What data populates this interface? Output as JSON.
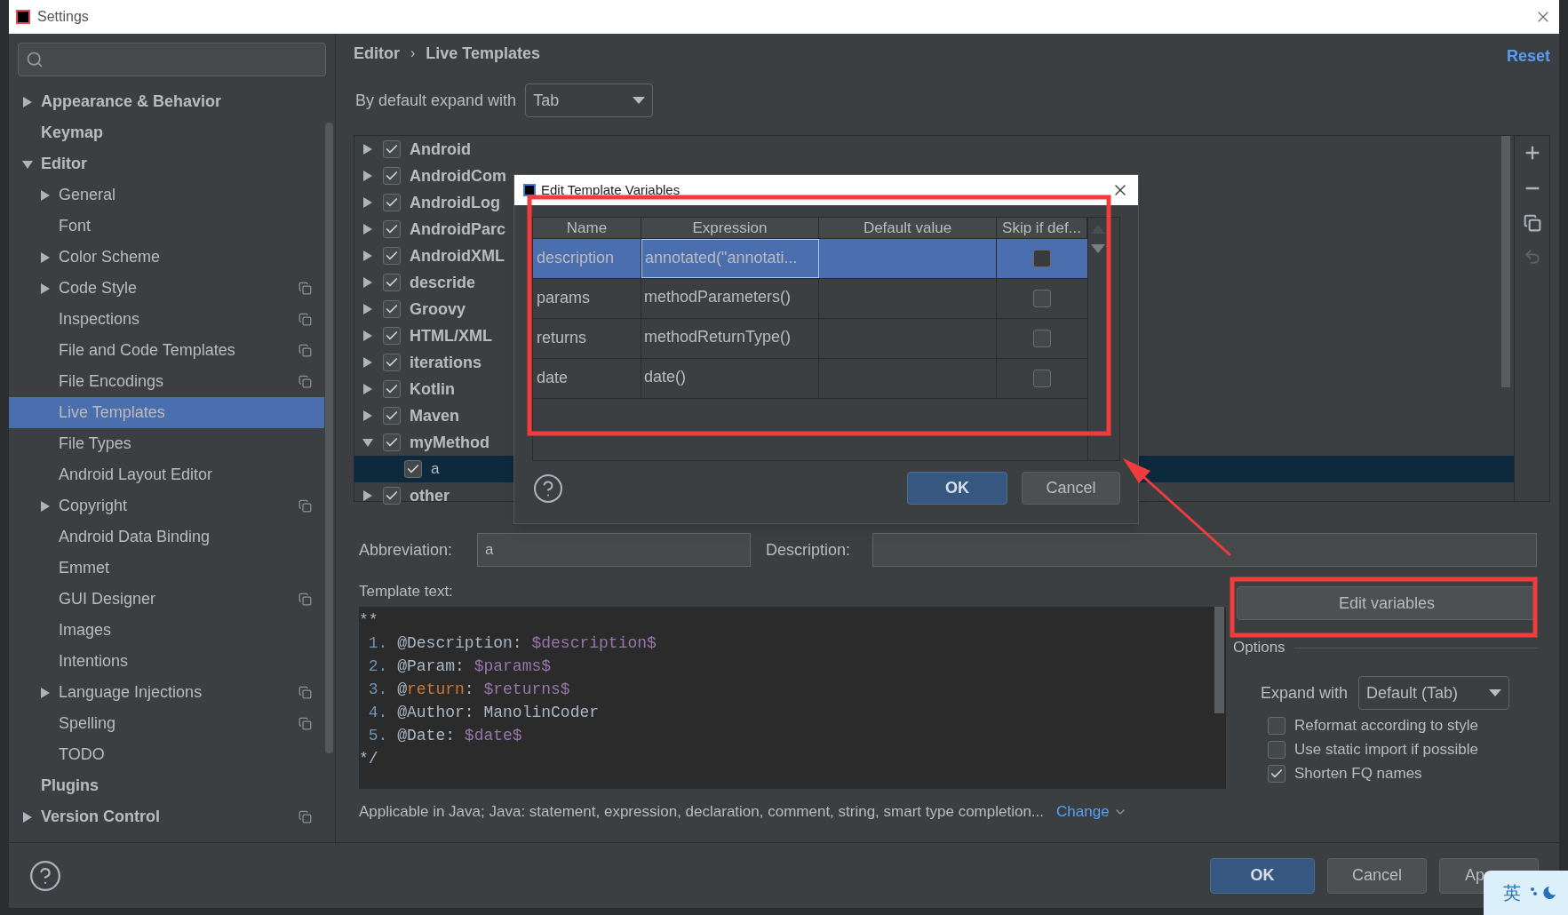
{
  "window": {
    "title": "Settings"
  },
  "sidebar": {
    "items": [
      {
        "label": "Appearance & Behavior",
        "kind": "node",
        "expanded": false,
        "selected": false,
        "project_level": false
      },
      {
        "label": "Keymap",
        "kind": "leaf",
        "selected": false,
        "project_level": false
      },
      {
        "label": "Editor",
        "kind": "node",
        "expanded": true,
        "selected": false,
        "project_level": false,
        "children": [
          {
            "label": "General",
            "kind": "node",
            "expanded": false,
            "selected": false,
            "project_level": false
          },
          {
            "label": "Font",
            "kind": "leaf",
            "selected": false,
            "project_level": false
          },
          {
            "label": "Color Scheme",
            "kind": "node",
            "expanded": false,
            "selected": false,
            "project_level": false
          },
          {
            "label": "Code Style",
            "kind": "node",
            "expanded": false,
            "selected": false,
            "project_level": true
          },
          {
            "label": "Inspections",
            "kind": "leaf",
            "selected": false,
            "project_level": true
          },
          {
            "label": "File and Code Templates",
            "kind": "leaf",
            "selected": false,
            "project_level": true
          },
          {
            "label": "File Encodings",
            "kind": "leaf",
            "selected": false,
            "project_level": true
          },
          {
            "label": "Live Templates",
            "kind": "leaf",
            "selected": true,
            "project_level": false
          },
          {
            "label": "File Types",
            "kind": "leaf",
            "selected": false,
            "project_level": false
          },
          {
            "label": "Android Layout Editor",
            "kind": "leaf",
            "selected": false,
            "project_level": false
          },
          {
            "label": "Copyright",
            "kind": "node",
            "expanded": false,
            "selected": false,
            "project_level": true
          },
          {
            "label": "Android Data Binding",
            "kind": "leaf",
            "selected": false,
            "project_level": false
          },
          {
            "label": "Emmet",
            "kind": "leaf",
            "selected": false,
            "project_level": false
          },
          {
            "label": "GUI Designer",
            "kind": "leaf",
            "selected": false,
            "project_level": true
          },
          {
            "label": "Images",
            "kind": "leaf",
            "selected": false,
            "project_level": false
          },
          {
            "label": "Intentions",
            "kind": "leaf",
            "selected": false,
            "project_level": false
          },
          {
            "label": "Language Injections",
            "kind": "node",
            "expanded": false,
            "selected": false,
            "project_level": true
          },
          {
            "label": "Spelling",
            "kind": "leaf",
            "selected": false,
            "project_level": true
          },
          {
            "label": "TODO",
            "kind": "leaf",
            "selected": false,
            "project_level": false
          }
        ]
      },
      {
        "label": "Plugins",
        "kind": "leaf",
        "selected": false,
        "project_level": false
      },
      {
        "label": "Version Control",
        "kind": "node",
        "expanded": false,
        "selected": false,
        "project_level": true
      }
    ]
  },
  "breadcrumb": [
    "Editor",
    "Live Templates"
  ],
  "breadcrumb_separator": "›",
  "reset_link": "Reset",
  "expand_default": {
    "label": "By default expand with",
    "value": "Tab"
  },
  "template_groups": [
    {
      "label": "Android",
      "checked": true,
      "expanded": false
    },
    {
      "label": "AndroidCom",
      "checked": true,
      "expanded": false
    },
    {
      "label": "AndroidLog",
      "checked": true,
      "expanded": false
    },
    {
      "label": "AndroidParc",
      "checked": true,
      "expanded": false
    },
    {
      "label": "AndroidXML",
      "checked": true,
      "expanded": false
    },
    {
      "label": "descride",
      "checked": true,
      "expanded": false
    },
    {
      "label": "Groovy",
      "checked": true,
      "expanded": false
    },
    {
      "label": "HTML/XML",
      "checked": true,
      "expanded": false
    },
    {
      "label": "iterations",
      "checked": true,
      "expanded": false
    },
    {
      "label": "Kotlin",
      "checked": true,
      "expanded": false
    },
    {
      "label": "Maven",
      "checked": true,
      "expanded": false
    },
    {
      "label": "myMethod",
      "checked": true,
      "expanded": true,
      "children": [
        {
          "label": "a",
          "checked": true,
          "selected": true
        }
      ]
    },
    {
      "label": "other",
      "checked": true,
      "expanded": false
    }
  ],
  "abbreviation": {
    "label": "Abbreviation:",
    "value": "a"
  },
  "description": {
    "label": "Description:"
  },
  "template_text": {
    "label": "Template text:",
    "lines": [
      {
        "segments": [
          {
            "kind": "text",
            "text": "**"
          }
        ]
      },
      {
        "segments": [
          {
            "kind": "number",
            "text": " 1. "
          },
          {
            "kind": "text",
            "text": "@Description: "
          },
          {
            "kind": "variable",
            "text": "$description$"
          }
        ]
      },
      {
        "segments": [
          {
            "kind": "number",
            "text": " 2. "
          },
          {
            "kind": "text",
            "text": "@Param: "
          },
          {
            "kind": "variable",
            "text": "$params$"
          }
        ]
      },
      {
        "segments": [
          {
            "kind": "number",
            "text": " 3. "
          },
          {
            "kind": "text",
            "text": "@"
          },
          {
            "kind": "keyword",
            "text": "return"
          },
          {
            "kind": "text",
            "text": ": "
          },
          {
            "kind": "variable",
            "text": "$returns$"
          }
        ]
      },
      {
        "segments": [
          {
            "kind": "number",
            "text": " 4. "
          },
          {
            "kind": "text",
            "text": "@Author: ManolinCoder"
          }
        ]
      },
      {
        "segments": [
          {
            "kind": "number",
            "text": " 5. "
          },
          {
            "kind": "text",
            "text": "@Date: "
          },
          {
            "kind": "variable",
            "text": "$date$"
          }
        ]
      },
      {
        "segments": [
          {
            "kind": "text",
            "text": "*/"
          }
        ]
      }
    ]
  },
  "applicable": {
    "text": "Applicable in Java; Java: statement, expression, declaration, comment, string, smart type completion...",
    "link": "Change"
  },
  "edit_variables_button": "Edit variables",
  "options": {
    "title": "Options",
    "expand_with": {
      "label": "Expand with",
      "value": "Default (Tab)"
    },
    "checkboxes": [
      {
        "label": "Reformat according to style",
        "checked": false
      },
      {
        "label": "Use static import if possible",
        "checked": false
      },
      {
        "label": "Shorten FQ names",
        "checked": true
      }
    ]
  },
  "buttons": [
    {
      "label": "OK",
      "primary": true
    },
    {
      "label": "Cancel",
      "primary": false
    },
    {
      "label": "Ap",
      "primary": false
    }
  ],
  "ime": {
    "label": "英"
  },
  "dialog": {
    "title": "Edit Template Variables",
    "columns": [
      "Name",
      "Expression",
      "Default value",
      "Skip if def..."
    ],
    "rows": [
      {
        "name": "description",
        "expression": "annotated(\"annotati...",
        "skip": false,
        "selected": true
      },
      {
        "name": "params",
        "expression": "methodParameters()",
        "skip": false,
        "selected": false
      },
      {
        "name": "returns",
        "expression": "methodReturnType()",
        "skip": false,
        "selected": false
      },
      {
        "name": "date",
        "expression": "date()",
        "skip": false,
        "selected": false
      }
    ],
    "buttons": [
      {
        "label": "OK",
        "primary": true
      },
      {
        "label": "Cancel",
        "primary": false
      }
    ]
  }
}
